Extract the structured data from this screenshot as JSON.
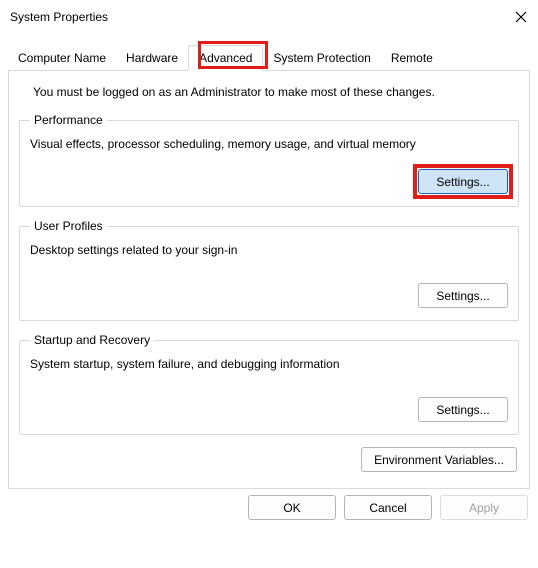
{
  "window": {
    "title": "System Properties"
  },
  "tabs": {
    "computer_name": "Computer Name",
    "hardware": "Hardware",
    "advanced": "Advanced",
    "system_protection": "System Protection",
    "remote": "Remote"
  },
  "advanced_panel": {
    "admin_note": "You must be logged on as an Administrator to make most of these changes.",
    "performance": {
      "legend": "Performance",
      "desc": "Visual effects, processor scheduling, memory usage, and virtual memory",
      "button": "Settings..."
    },
    "user_profiles": {
      "legend": "User Profiles",
      "desc": "Desktop settings related to your sign-in",
      "button": "Settings..."
    },
    "startup_recovery": {
      "legend": "Startup and Recovery",
      "desc": "System startup, system failure, and debugging information",
      "button": "Settings..."
    },
    "env_button": "Environment Variables..."
  },
  "dialog_buttons": {
    "ok": "OK",
    "cancel": "Cancel",
    "apply": "Apply"
  }
}
